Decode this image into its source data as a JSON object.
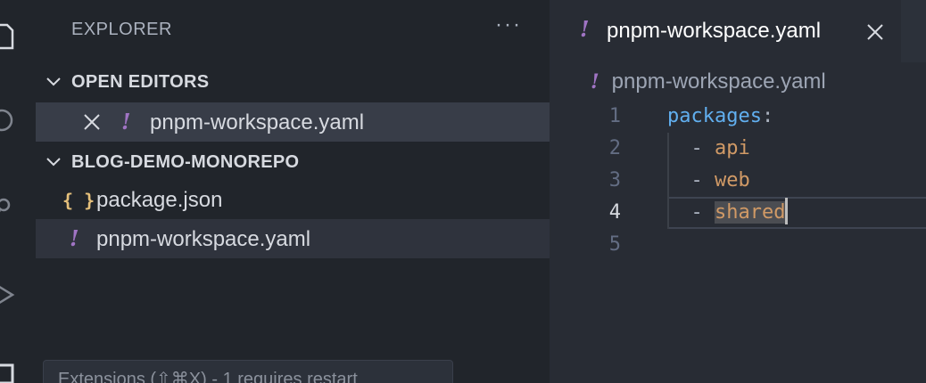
{
  "activity_bar": {
    "icons": [
      "files-icon",
      "search-icon",
      "source-control-icon",
      "run-debug-icon",
      "extensions-icon"
    ]
  },
  "sidebar": {
    "title": "EXPLORER",
    "more_actions": "···",
    "open_editors": {
      "header": "OPEN EDITORS",
      "items": [
        {
          "label": "pnpm-workspace.yaml",
          "icon": "yaml-icon",
          "icon_glyph": "!"
        }
      ]
    },
    "project": {
      "header": "BLOG-DEMO-MONOREPO",
      "items": [
        {
          "label": "package.json",
          "icon": "json-icon",
          "icon_glyph": "{ }"
        },
        {
          "label": "pnpm-workspace.yaml",
          "icon": "yaml-icon",
          "icon_glyph": "!"
        }
      ]
    }
  },
  "editor": {
    "tab": {
      "label": "pnpm-workspace.yaml",
      "icon_glyph": "!"
    },
    "breadcrumb": {
      "label": "pnpm-workspace.yaml",
      "icon_glyph": "!"
    },
    "lines": [
      {
        "num": "1",
        "key": "packages",
        "colon": ":"
      },
      {
        "num": "2",
        "dash": "- ",
        "value": "api"
      },
      {
        "num": "3",
        "dash": "- ",
        "value": "web"
      },
      {
        "num": "4",
        "dash": "- ",
        "value": "shared"
      },
      {
        "num": "5"
      }
    ],
    "current_line": "4"
  },
  "tooltip": {
    "text": "Extensions (⇧⌘X) - 1 requires restart"
  },
  "colors": {
    "sidebar_bg": "#21252b",
    "editor_bg": "#282c34",
    "yaml_icon": "#a074c4",
    "json_icon": "#e5c07b",
    "key": "#61afef",
    "string": "#d19a66"
  }
}
